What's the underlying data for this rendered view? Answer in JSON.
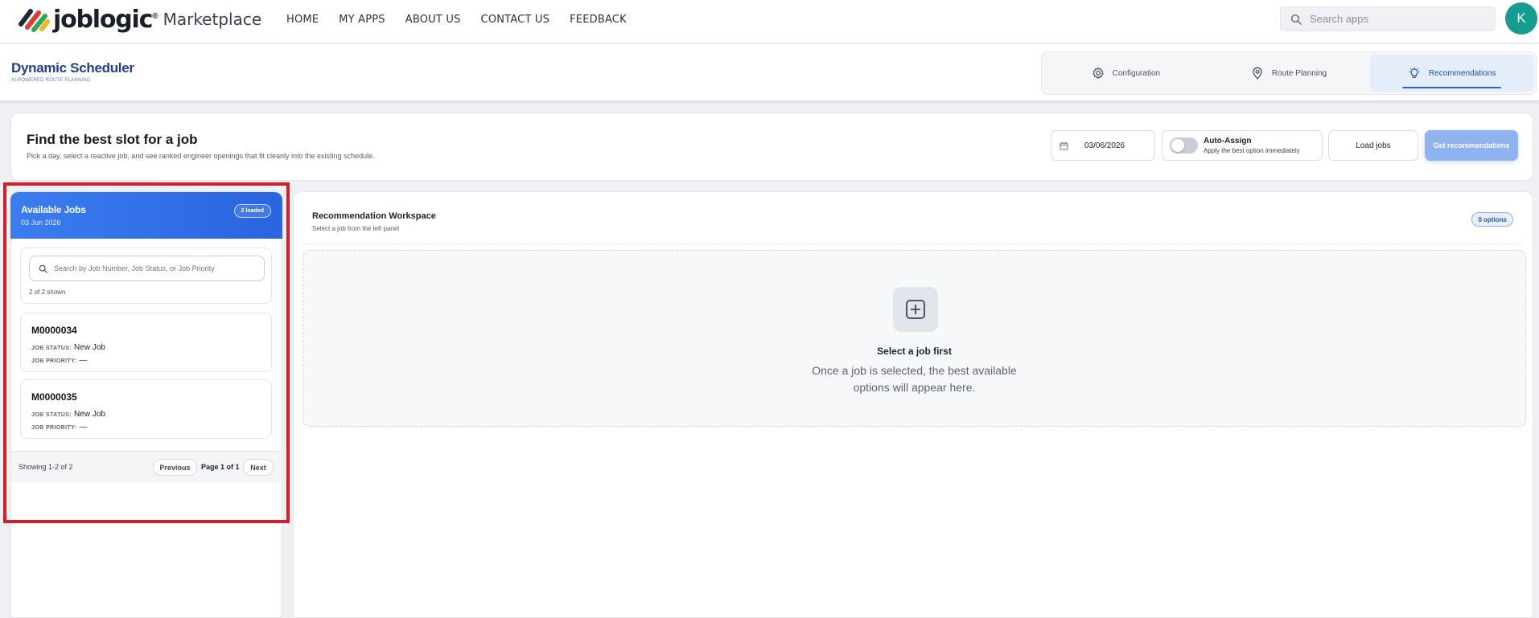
{
  "topbar": {
    "brand": "joblogic",
    "brand_mark": "®",
    "brand_suffix": "Marketplace",
    "nav": [
      "HOME",
      "MY APPS",
      "ABOUT US",
      "CONTACT US",
      "FEEDBACK"
    ],
    "search_placeholder": "Search apps",
    "avatar_initial": "K",
    "avatar_color": "#169c8f"
  },
  "app": {
    "title": "Dynamic Scheduler",
    "subtitle": "AI-POWERED ROUTE PLANNING",
    "tabs": [
      {
        "label": "Configuration",
        "icon": "gear-icon",
        "active": false
      },
      {
        "label": "Route Planning",
        "icon": "map-pin-icon",
        "active": false
      },
      {
        "label": "Recommendations",
        "icon": "lightbulb-icon",
        "active": true
      }
    ]
  },
  "find": {
    "title": "Find the best slot for a job",
    "description": "Pick a day, select a reactive job, and see ranked engineer openings that fit cleanly into the existing schedule.",
    "date": "03/06/2026",
    "auto_assign_label": "Auto-Assign",
    "auto_assign_sub": "Apply the best option immediately",
    "load_button": "Load jobs",
    "recommend_button": "Get recommendations"
  },
  "jobs_panel": {
    "title": "Available Jobs",
    "date": "03 Jun 2026",
    "badge": "2 loaded",
    "search_placeholder": "Search by Job Number, Job Status, or Job Priority",
    "shown": "2 of 2 shown",
    "status_label": "JOB STATUS:",
    "priority_label": "JOB PRIORITY:",
    "jobs": [
      {
        "number": "M0000034",
        "status": "New Job",
        "priority": "—"
      },
      {
        "number": "M0000035",
        "status": "New Job",
        "priority": "—"
      }
    ],
    "pager": {
      "info": "Showing 1-2 of 2",
      "previous": "Previous",
      "page": "Page 1 of 1",
      "next": "Next"
    }
  },
  "workspace": {
    "title": "Recommendation Workspace",
    "subtitle": "Select a job from the left panel",
    "badge": "0 options",
    "empty_title": "Select a job first",
    "empty_line1": "Once a job is selected, the best available",
    "empty_line2": "options will appear here."
  },
  "colors": {
    "accent": "#2a64e0",
    "highlight": "#d81d24"
  }
}
